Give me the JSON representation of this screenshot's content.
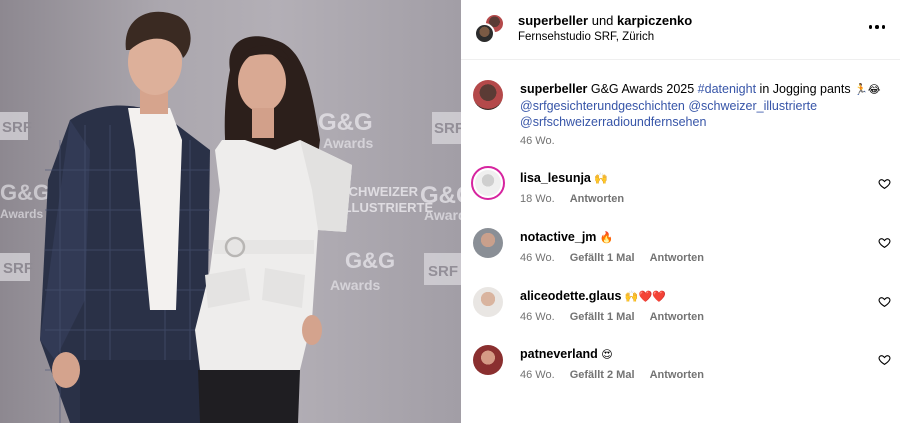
{
  "post": {
    "authors": {
      "first": "superbeller",
      "joiner": "und",
      "second": "karpiczenko"
    },
    "location": "Fernsehstudio SRF, Zürich",
    "more_icon": "more-horizontal-icon",
    "backdrop_logos": [
      "SRF",
      "G&G",
      "Awards",
      "SCHWEIZER",
      "ILLUSTRIERTE"
    ]
  },
  "caption": {
    "username": "superbeller",
    "text_before": "G&G Awards 2025",
    "hashtag": "#datenight",
    "text_after": "in Jogging pants",
    "emojis": "🏃😂",
    "mention_1": "@srfgesichterundgeschichten",
    "mention_2": "@schweizer_illustrierte",
    "mention_3": "@srfschweizerradioundfernsehen",
    "time": "46 Wo."
  },
  "comments": [
    {
      "username": "lisa_lesunja",
      "emoji": "🙌",
      "time": "18 Wo.",
      "likes": "",
      "reply": "Antworten"
    },
    {
      "username": "notactive_jm",
      "emoji": "🔥",
      "time": "46 Wo.",
      "likes": "Gefällt 1 Mal",
      "reply": "Antworten"
    },
    {
      "username": "aliceodette.glaus",
      "emoji": "🙌❤️❤️",
      "time": "46 Wo.",
      "likes": "Gefällt 1 Mal",
      "reply": "Antworten"
    },
    {
      "username": "patneverland",
      "emoji": "😍",
      "time": "46 Wo.",
      "likes": "Gefällt 2 Mal",
      "reply": "Antworten"
    }
  ],
  "colors": {
    "link": "#3755a8",
    "meta": "#737373",
    "story_ring": "#d6249f"
  }
}
